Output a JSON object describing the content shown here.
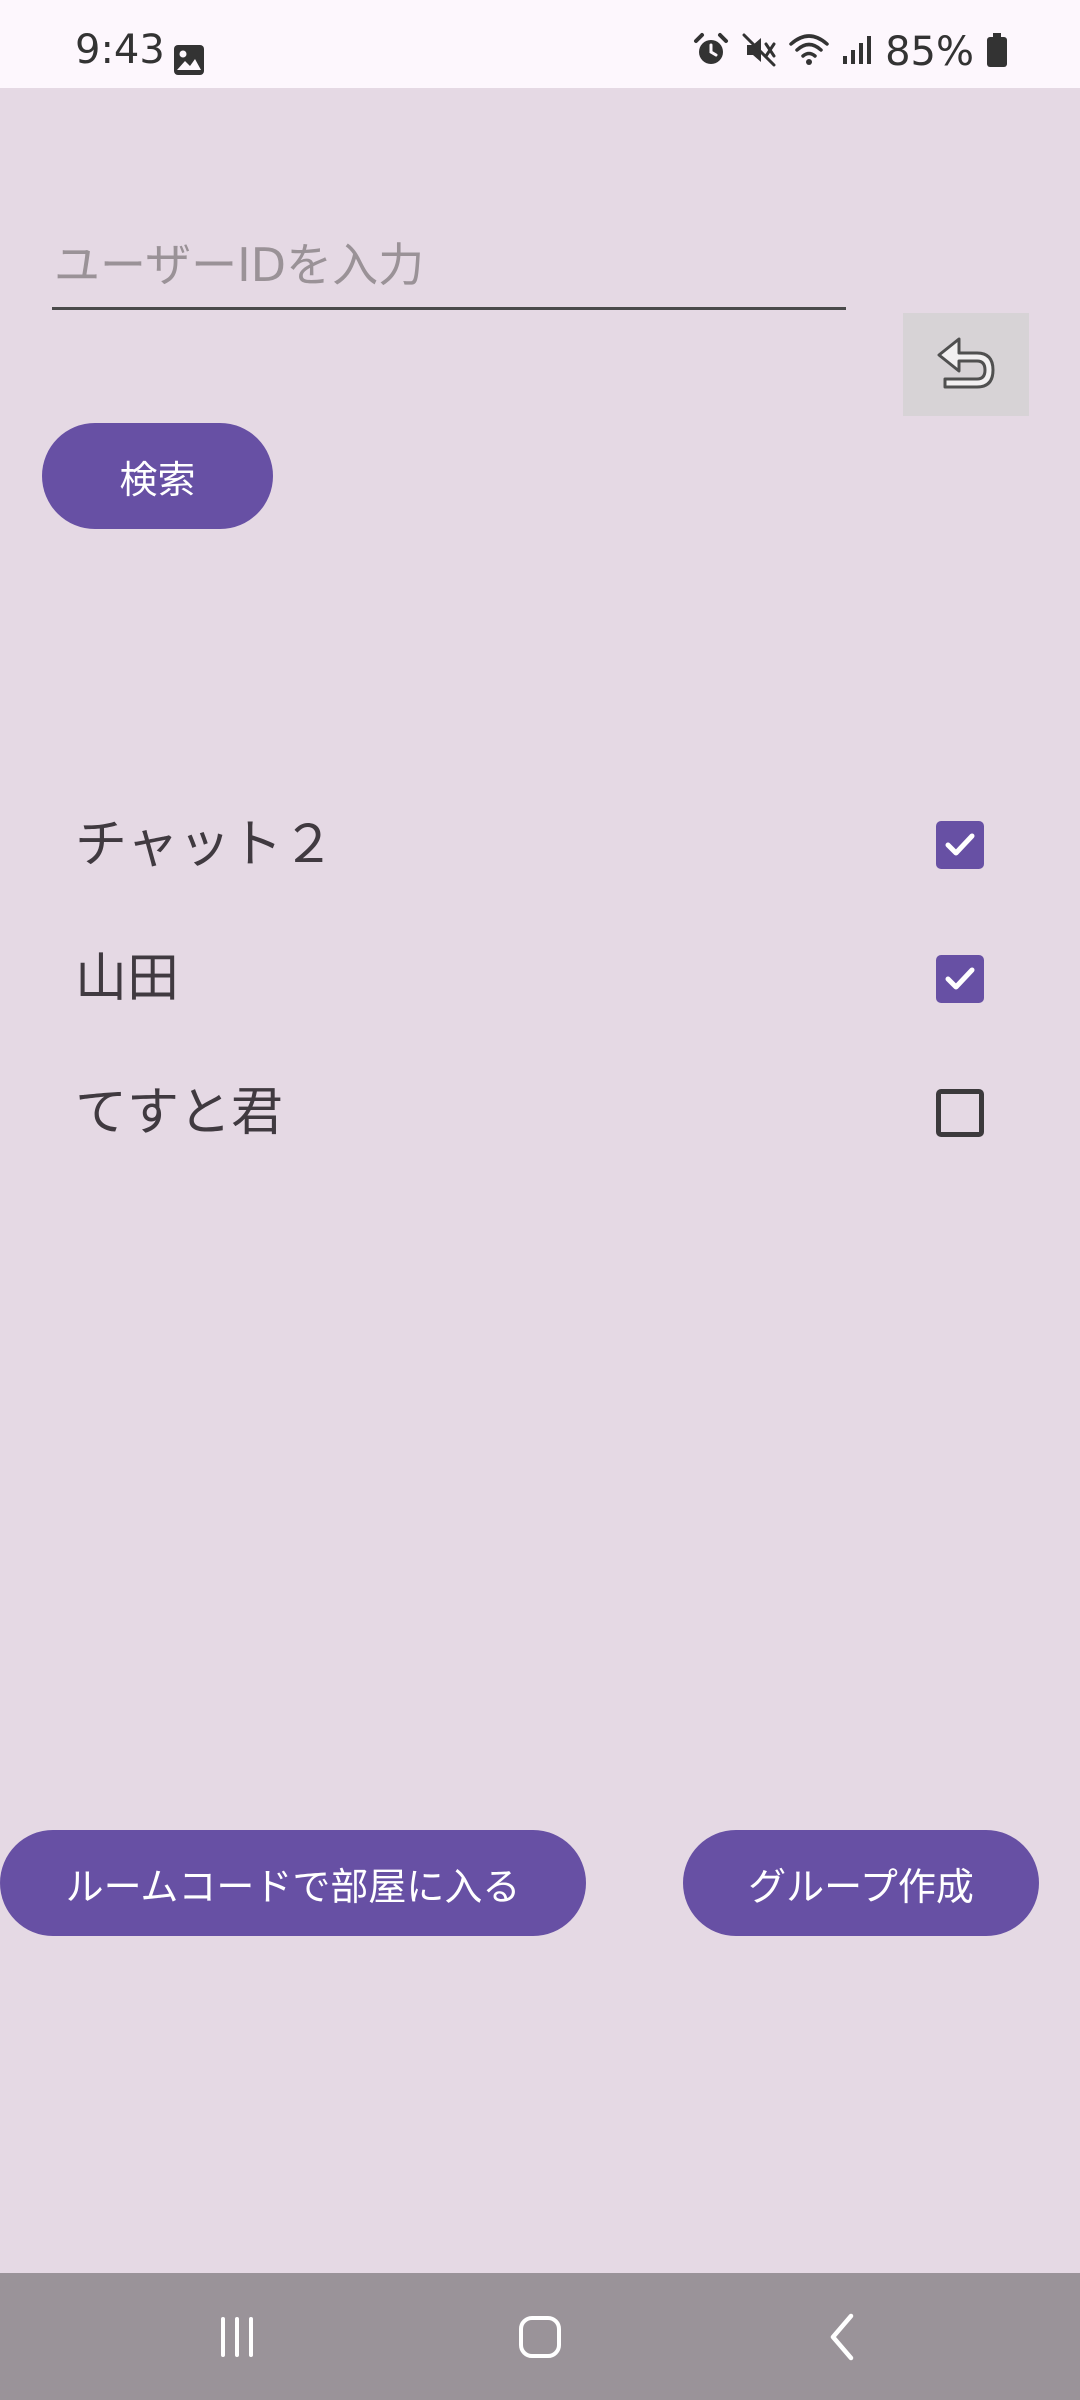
{
  "status_bar": {
    "time": "9:43",
    "battery": "85%",
    "icons": [
      "gallery-icon",
      "alarm-icon",
      "mute-icon",
      "wifi-icon",
      "signal-icon",
      "battery-icon"
    ]
  },
  "search": {
    "placeholder": "ユーザーIDを入力",
    "value": "",
    "button_label": "検索"
  },
  "undo_button": {
    "icon": "undo-icon"
  },
  "members": [
    {
      "name": "チャット２",
      "checked": true
    },
    {
      "name": "山田",
      "checked": true
    },
    {
      "name": "てすと君",
      "checked": false
    }
  ],
  "actions": {
    "room_code_label": "ルームコードで部屋に入る",
    "create_group_label": "グループ作成"
  },
  "nav_bar": {
    "items": [
      "recent-apps-icon",
      "home-icon",
      "back-icon"
    ]
  },
  "colors": {
    "background": "#e5d9e4",
    "accent": "#6750a4",
    "status_bar": "#fdf7fd",
    "nav_bar": "#9a9399"
  }
}
